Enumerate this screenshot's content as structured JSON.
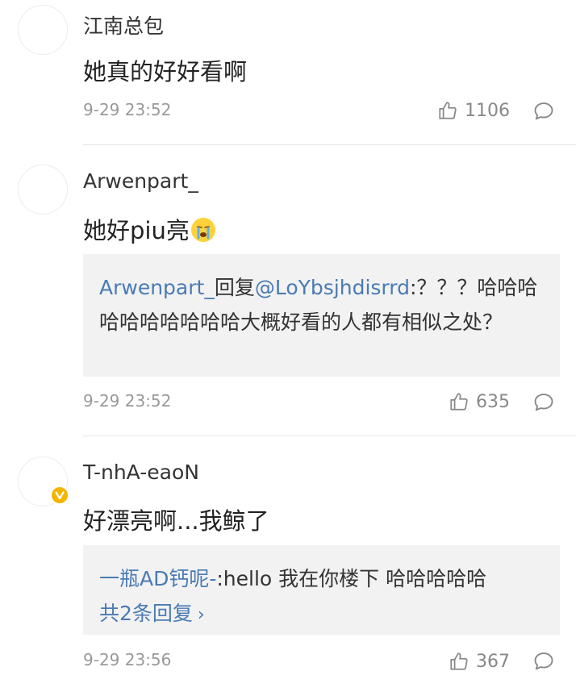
{
  "comments": [
    {
      "username": "江南总包",
      "text": "她真的好好看啊",
      "time": "9-29 23:52",
      "likes": "1106"
    },
    {
      "username": "Arwenpart_",
      "text": "她好piu亮",
      "emoji": "crying-face-emoji",
      "reply": {
        "author": "Arwenpart_",
        "verb": "回复",
        "mention": "@LoYbsjhdisrrd",
        "text": ":？？？哈哈哈哈哈哈哈哈哈哈大概好看的人都有相似之处？"
      },
      "time": "9-29 23:52",
      "likes": "635"
    },
    {
      "username": "T-nhA-eaoN",
      "verified": true,
      "text": "好漂亮啊...我鲸了",
      "reply": {
        "author": "一瓶AD钙呢-",
        "text": ":hello 我在你楼下 哈哈哈哈哈",
        "more": "共2条回复"
      },
      "time": "9-29 23:56",
      "likes": "367"
    }
  ],
  "colors": {
    "link": "#4a7bb3",
    "quote_bg": "#f2f2f2",
    "badge": "#f5b400"
  }
}
